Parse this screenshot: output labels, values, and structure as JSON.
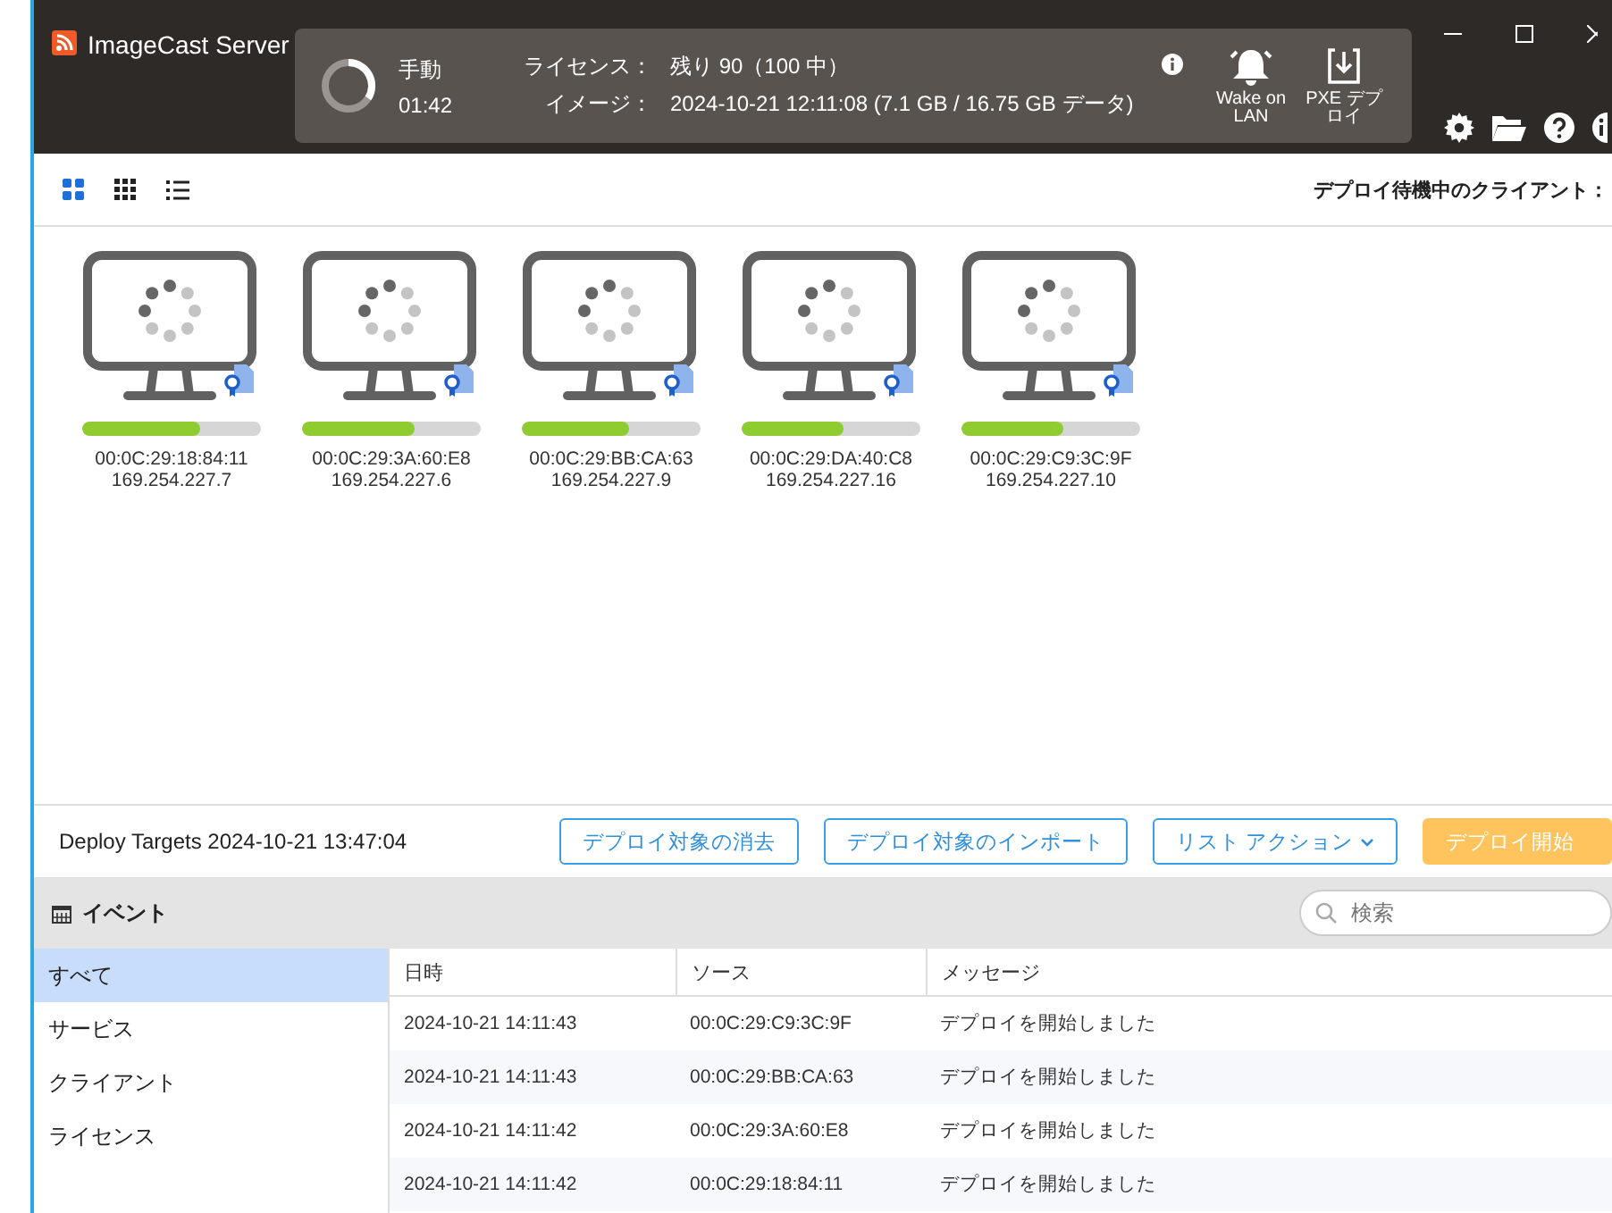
{
  "app": {
    "title": "ImageCast Server"
  },
  "status": {
    "mode": "手動",
    "time": "01:42",
    "license_label": "ライセンス：",
    "license_value": "残り 90（100 中）",
    "image_label": "イメージ：",
    "image_value": "2024-10-21 12:11:08 (7.1 GB / 16.75 GB データ)"
  },
  "header_actions": [
    {
      "label": "Wake on LAN",
      "kind": "bell"
    },
    {
      "label": "PXE デプロイ",
      "kind": "download"
    }
  ],
  "view_modes": [
    {
      "kind": "large",
      "selected": true
    },
    {
      "kind": "small",
      "selected": false
    },
    {
      "kind": "list",
      "selected": false
    }
  ],
  "clients_label": "デプロイ待機中のクライアント：",
  "clients": [
    {
      "mac": "00:0C:29:18:84:11",
      "ip": "169.254.227.7",
      "level": 0.66
    },
    {
      "mac": "00:0C:29:3A:60:E8",
      "ip": "169.254.227.6",
      "level": 0.63
    },
    {
      "mac": "00:0C:29:BB:CA:63",
      "ip": "169.254.227.9",
      "level": 0.6
    },
    {
      "mac": "00:0C:29:DA:40:C8",
      "ip": "169.254.227.16",
      "level": 0.57
    },
    {
      "mac": "00:0C:29:C9:3C:9F",
      "ip": "169.254.227.10",
      "level": 0.57
    }
  ],
  "deploy_targets": "Deploy Targets 2024-10-21 13:47:04",
  "buttons": [
    {
      "label": "デプロイ対象の消去",
      "kind": "outline"
    },
    {
      "label": "デプロイ対象のインポート",
      "kind": "outline"
    },
    {
      "label": "リスト アクション",
      "kind": "dropdown"
    },
    {
      "label": "デプロイ開始",
      "kind": "primary"
    }
  ],
  "events": {
    "title": "イベント",
    "search": {
      "placeholder": "検索"
    },
    "categories": [
      {
        "label": "すべて",
        "selected": true
      },
      {
        "label": "サービス",
        "selected": false
      },
      {
        "label": "クライアント",
        "selected": false
      },
      {
        "label": "ライセンス",
        "selected": false
      }
    ],
    "columns": [
      "日時",
      "ソース",
      "メッセージ"
    ],
    "rows": [
      [
        "2024-10-21 14:11:43",
        "00:0C:29:C9:3C:9F",
        "デプロイを開始しました"
      ],
      [
        "2024-10-21 14:11:43",
        "00:0C:29:BB:CA:63",
        "デプロイを開始しました"
      ],
      [
        "2024-10-21 14:11:42",
        "00:0C:29:3A:60:E8",
        "デプロイを開始しました"
      ],
      [
        "2024-10-21 14:11:42",
        "00:0C:29:18:84:11",
        "デプロイを開始しました"
      ]
    ]
  }
}
